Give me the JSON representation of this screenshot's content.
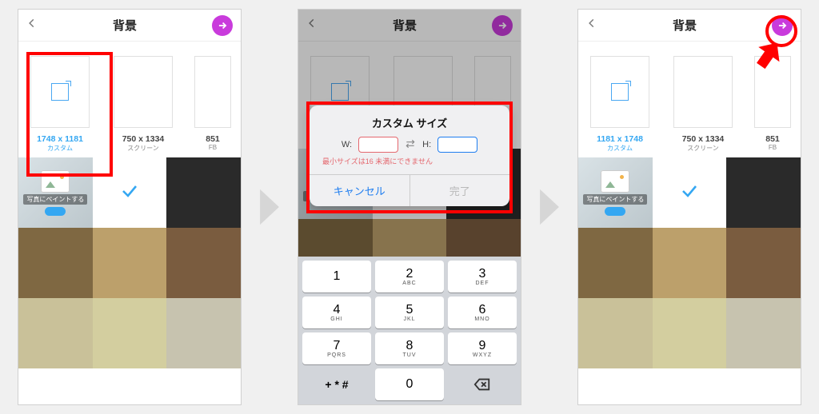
{
  "screens": {
    "header": {
      "title": "背景"
    },
    "sizes": {
      "s1_custom": {
        "caption": "1748 x 1181",
        "sub": "カスタム"
      },
      "s3_custom": {
        "caption": "1181 x 1748",
        "sub": "カスタム"
      },
      "screen": {
        "caption": "750 x 1334",
        "sub": "スクリーン"
      },
      "fb": {
        "caption": "851",
        "sub": "FB"
      }
    },
    "photo_cell": {
      "label": "写真にペイントする"
    },
    "dialog": {
      "title": "カスタム サイズ",
      "w_label": "W:",
      "h_label": "H:",
      "error": "最小サイズは16 未満にできません",
      "cancel": "キャンセル",
      "done": "完了"
    },
    "keypad": {
      "k1": {
        "d": "1",
        "l": ""
      },
      "k2": {
        "d": "2",
        "l": "ABC"
      },
      "k3": {
        "d": "3",
        "l": "DEF"
      },
      "k4": {
        "d": "4",
        "l": "GHI"
      },
      "k5": {
        "d": "5",
        "l": "JKL"
      },
      "k6": {
        "d": "6",
        "l": "MNO"
      },
      "k7": {
        "d": "7",
        "l": "PQRS"
      },
      "k8": {
        "d": "8",
        "l": "TUV"
      },
      "k9": {
        "d": "9",
        "l": "WXYZ"
      },
      "k0": {
        "d": "0",
        "l": ""
      },
      "ksym": "+ * #"
    },
    "bg_colors": [
      "#ffffff",
      "#2a2a2a",
      "#bda06f",
      "#7a5c3f",
      "#5f4a31",
      "#cbc59a",
      "#d4cfa2",
      "#c9c4b7",
      "#c7c3af",
      "#b7b39d"
    ]
  }
}
